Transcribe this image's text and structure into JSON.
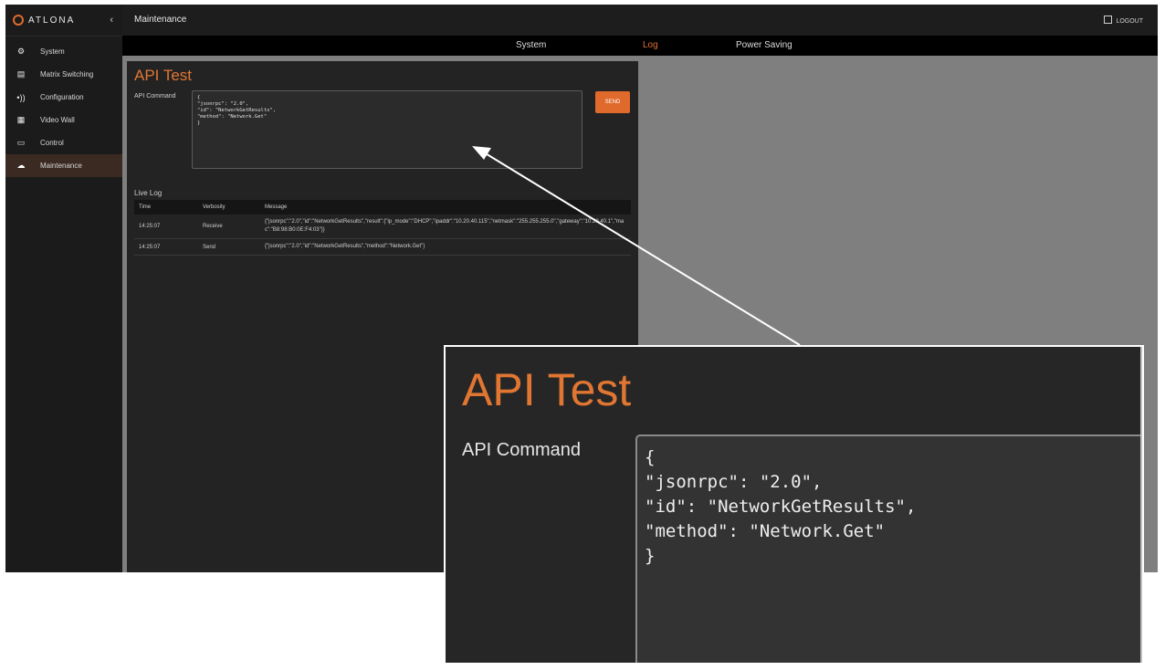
{
  "sidebar": {
    "logo": "ATLONA",
    "collapse_icon": "chevron-left-icon",
    "items": [
      {
        "label": "System",
        "icon": "gear-icon"
      },
      {
        "label": "Matrix Switching",
        "icon": "input-icon"
      },
      {
        "label": "Configuration",
        "icon": "sound-icon"
      },
      {
        "label": "Video Wall",
        "icon": "grid-icon"
      },
      {
        "label": "Control",
        "icon": "monitor-icon"
      },
      {
        "label": "Maintenance",
        "icon": "cloud-icon"
      }
    ],
    "active_index": 5
  },
  "header": {
    "title": "Maintenance",
    "logout": "LOGOUT"
  },
  "tabs": [
    {
      "label": "System"
    },
    {
      "label": "Log"
    },
    {
      "label": "Power Saving"
    }
  ],
  "api_test": {
    "title": "API Test",
    "command_label": "API Command",
    "command_lines": [
      "{",
      "\"jsonrpc\": \"2.0\",",
      "\"id\": \"NetworkGetResults\",",
      "\"method\": \"Network.Get\"",
      "}"
    ],
    "send_label": "SEND"
  },
  "live_log": {
    "label": "Live Log",
    "columns": [
      "Time",
      "Verbosity",
      "Message"
    ],
    "rows": [
      {
        "time": "14:25:07",
        "verbosity": "Receive",
        "message": "{\"jsonrpc\":\"2.0\",\"id\":\"NetworkGetResults\",\"result\":{\"ip_mode\":\"DHCP\",\"ipaddr\":\"10.20.40.115\",\"netmask\":\"255.255.255.0\",\"gateway\":\"10.20.40.1\",\"mac\":\"B8:98:B0:0E:F4:03\"}}"
      },
      {
        "time": "14:25:07",
        "verbosity": "Send",
        "message": "{\"jsonrpc\":\"2.0\",\"id\":\"NetworkGetResults\",\"method\":\"Network.Get\"}"
      }
    ]
  },
  "zoom": {
    "title": "API Test",
    "command_label": "API Command",
    "command_lines": [
      "{",
      "\"jsonrpc\": \"2.0\",",
      "\"id\": \"NetworkGetResults\",",
      "\"method\": \"Network.Get\"",
      "}"
    ]
  },
  "colors": {
    "accent": "#e06a2c",
    "sidebar_bg": "#1b1b1b",
    "panel_bg": "#232323"
  }
}
